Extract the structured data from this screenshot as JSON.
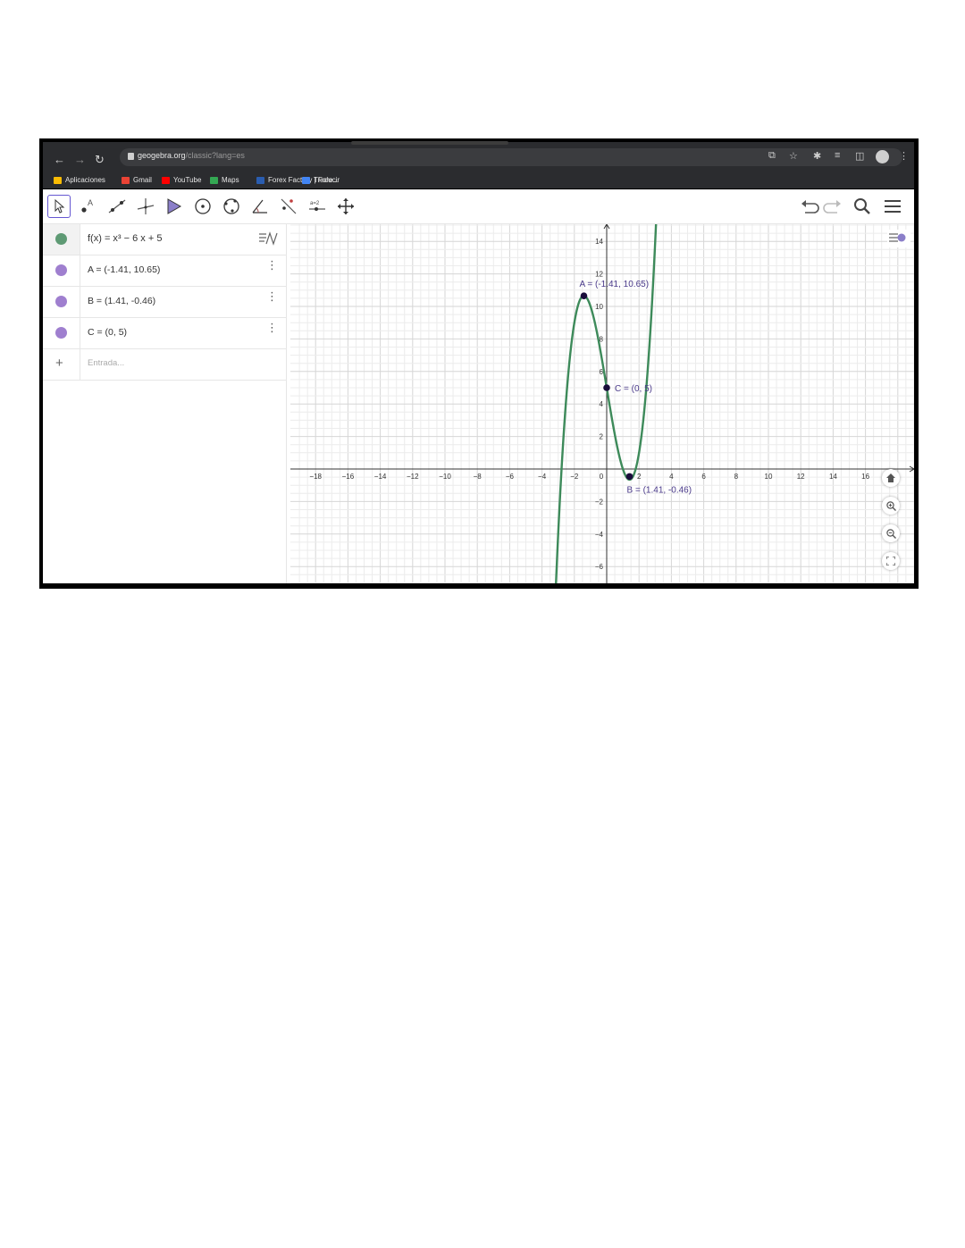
{
  "browser": {
    "url_host": "geogebra.org",
    "url_path": "/classic?lang=es",
    "bookmarks": [
      {
        "label": "Aplicaciones",
        "color": "#fbbc04"
      },
      {
        "label": "Gmail",
        "color": "#ea4335"
      },
      {
        "label": "YouTube",
        "color": "#ff0000"
      },
      {
        "label": "Maps",
        "color": "#34a853"
      },
      {
        "label": "Forex Factory | Fore...",
        "color": "#2a5db0"
      },
      {
        "label": "Traducir",
        "color": "#4285f4"
      }
    ]
  },
  "toolbar": {
    "tools": [
      "move-tool",
      "point-tool",
      "line-tool",
      "perpendicular-line-tool",
      "polygon-tool",
      "circle-center-tool",
      "circle-three-points-tool",
      "angle-tool",
      "reflect-tool",
      "slider-tool",
      "move-graphics-tool"
    ],
    "slider_label": "a=2"
  },
  "algebra": {
    "function": {
      "text": "f(x) = x³ − 6 x + 5",
      "color": "#5e9a74"
    },
    "points": [
      {
        "text": "A = (-1.41, 10.65)",
        "color": "#9f7fcf"
      },
      {
        "text": "B = (1.41, -0.46)",
        "color": "#9f7fcf"
      },
      {
        "text": "C = (0, 5)",
        "color": "#9f7fcf"
      }
    ],
    "input_placeholder": "Entrada..."
  },
  "chart_data": {
    "type": "line",
    "xlim": [
      -19,
      19.5
    ],
    "ylim": [
      -7,
      15
    ],
    "x_ticks": [
      -18,
      -16,
      -14,
      -12,
      -10,
      -8,
      -6,
      -4,
      -2,
      0,
      2,
      4,
      6,
      8,
      10,
      12,
      14,
      16
    ],
    "y_ticks": [
      -6,
      -4,
      -2,
      2,
      4,
      6,
      8,
      10,
      12,
      14
    ],
    "grid": true,
    "curve_color": "#3d8a5a",
    "series": [
      {
        "name": "f",
        "expression": "x^3 - 6x + 5"
      }
    ],
    "points": [
      {
        "label": "A = (-1.41, 10.65)",
        "x": -1.41,
        "y": 10.65
      },
      {
        "label": "B = (1.41, -0.46)",
        "x": 1.41,
        "y": -0.46
      },
      {
        "label": "C = (0, 5)",
        "x": 0,
        "y": 5
      }
    ]
  }
}
